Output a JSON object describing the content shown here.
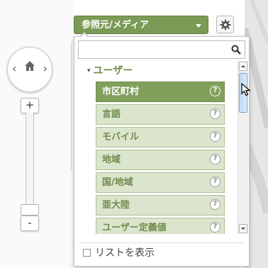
{
  "source_dropdown": {
    "label": "参照元/メディア"
  },
  "search": {
    "placeholder": "",
    "value": ""
  },
  "group": {
    "label": "ユーザー"
  },
  "items": [
    {
      "label": "市区町村",
      "selected": true
    },
    {
      "label": "言語",
      "selected": false
    },
    {
      "label": "モバイル",
      "selected": false
    },
    {
      "label": "地域",
      "selected": false
    },
    {
      "label": "国/地域",
      "selected": false
    },
    {
      "label": "亜大陸",
      "selected": false
    },
    {
      "label": "ユーザー定義値",
      "selected": false
    }
  ],
  "help_glyph": "?",
  "footer": {
    "show_list_label": "リストを表示",
    "show_list_checked": false
  },
  "zoom": {
    "in_label": "+",
    "out_label": "-"
  },
  "pan": {
    "left": "‹",
    "right": "›"
  },
  "colors": {
    "accent_green": "#7a9a55",
    "item_bg": "#dbe5cd",
    "item_text": "#708b4f",
    "selected_bg": "#80a05b"
  },
  "icons": {
    "settings": "gear-icon",
    "search": "search-icon",
    "home": "home-icon",
    "help": "help-icon",
    "caret": "caret-down-icon"
  }
}
